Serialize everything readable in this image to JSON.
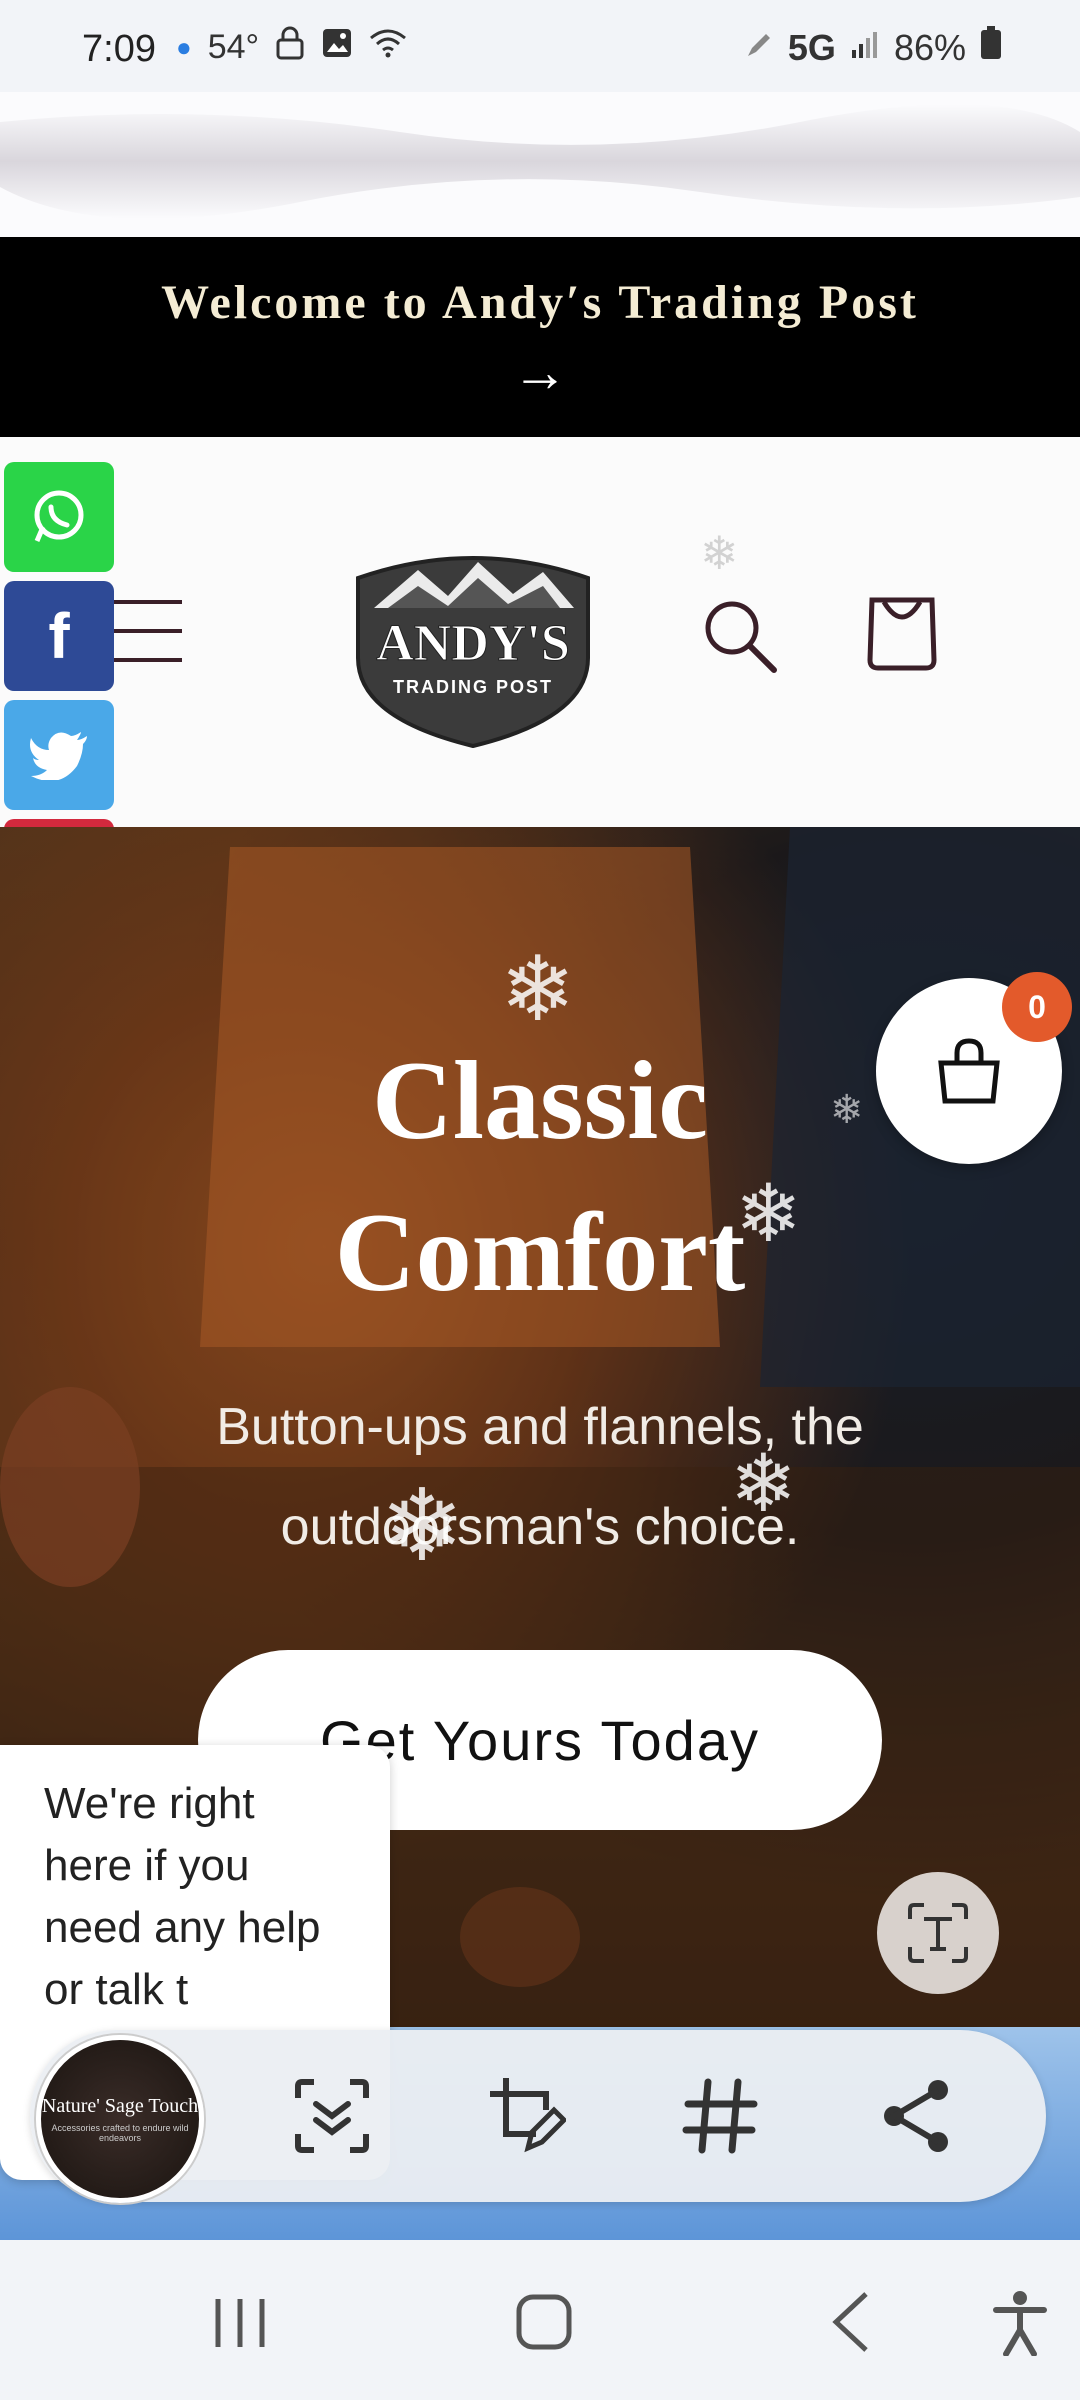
{
  "status_bar": {
    "time": "7:09",
    "temp": "54°",
    "network": "5G",
    "battery": "86%"
  },
  "announcement": {
    "text": "Welcome to Andy′s Trading Post",
    "arrow": "→"
  },
  "header": {
    "logo_name": "ANDY'S",
    "logo_tagline": "TRADING POST"
  },
  "social": [
    "whatsapp-icon",
    "facebook-icon",
    "twitter-icon",
    "pinterest-icon",
    "youtube-icon",
    "instagram-icon",
    "messenger-icon"
  ],
  "hero": {
    "title_line1": "Classic",
    "title_line2": "Comfort",
    "subtitle_line1": "Button-ups and flannels, the",
    "subtitle_line2": "outdoorsman's choice.",
    "cta_label": "Get Yours Today"
  },
  "floating_cart": {
    "count": "0"
  },
  "chat": {
    "message": "We're right here if you need any help or talk t"
  },
  "toolbar": {
    "thumb_title": "Nature' Sage Touch",
    "thumb_caption": "Accessories crafted to endure wild endeavors"
  },
  "colors": {
    "announcement_bg": "#000000",
    "badge": "#e35a2b",
    "brand_dark": "#3a1f28"
  }
}
